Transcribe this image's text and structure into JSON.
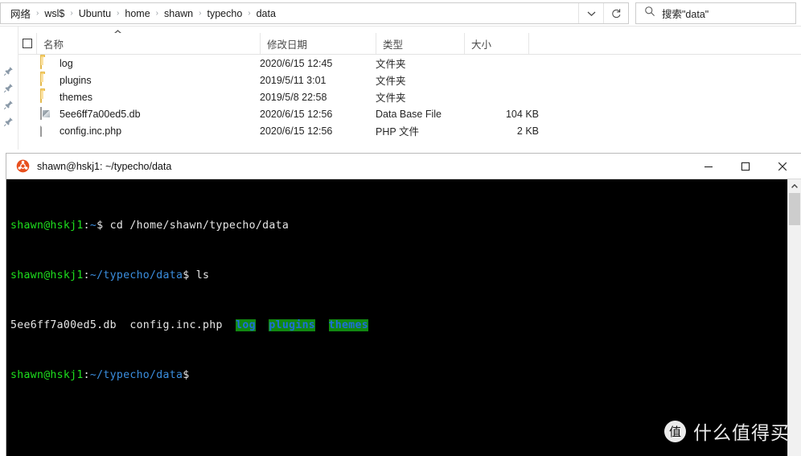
{
  "explorer": {
    "address": {
      "breadcrumbs": [
        "网络",
        "wsl$",
        "Ubuntu",
        "home",
        "shawn",
        "typecho",
        "data"
      ],
      "separator": "›",
      "dropdown_label": "⌄",
      "refresh_label": "↻"
    },
    "search": {
      "value": "搜索\"data\"",
      "icon": "search-icon"
    },
    "columns": {
      "name": "名称",
      "date_modified": "修改日期",
      "type": "类型",
      "size": "大小",
      "sort_indicator": "⌃"
    },
    "files": [
      {
        "icon": "folder-icon",
        "name": "log",
        "date": "2020/6/15 12:45",
        "type": "文件夹",
        "size": ""
      },
      {
        "icon": "folder-icon",
        "name": "plugins",
        "date": "2019/5/11 3:01",
        "type": "文件夹",
        "size": ""
      },
      {
        "icon": "folder-icon",
        "name": "themes",
        "date": "2019/5/8 22:58",
        "type": "文件夹",
        "size": ""
      },
      {
        "icon": "database-icon",
        "name": "5ee6ff7a00ed5.db",
        "date": "2020/6/15 12:56",
        "type": "Data Base File",
        "size": "104 KB"
      },
      {
        "icon": "document-icon",
        "name": "config.inc.php",
        "date": "2020/6/15 12:56",
        "type": "PHP 文件",
        "size": "2 KB"
      }
    ],
    "pins": [
      "pin-icon",
      "pin-icon",
      "pin-icon",
      "pin-icon"
    ]
  },
  "terminal": {
    "title": "shawn@hskj1: ~/typecho/data",
    "app_icon": "ubuntu-icon",
    "window_buttons": {
      "minimize": "minimize-icon",
      "maximize": "maximize-icon",
      "close": "close-icon"
    },
    "prompt_user": "shawn@hskj1",
    "colon": ":",
    "lines": [
      {
        "user": "shawn@hskj1",
        "colon": ":",
        "path": "~",
        "rest": "$ cd /home/shawn/typecho/data"
      },
      {
        "user": "shawn@hskj1",
        "colon": ":",
        "path": "~/typecho/data",
        "rest": "$ ls"
      }
    ],
    "ls_output": {
      "files": [
        "5ee6ff7a00ed5.db",
        "config.inc.php"
      ],
      "dirs": [
        "log",
        "plugins",
        "themes"
      ]
    },
    "last_prompt": {
      "user": "shawn@hskj1",
      "colon": ":",
      "path": "~/typecho/data",
      "rest": "$"
    },
    "colors": {
      "prompt_user": "#1ee01e",
      "path": "#3b8fe0",
      "dir_bg": "#118811",
      "dir_fg": "#1e6fd9",
      "background": "#000000",
      "text": "#e6e6e6"
    }
  },
  "watermark": {
    "badge": "值",
    "text": "什么值得买"
  }
}
